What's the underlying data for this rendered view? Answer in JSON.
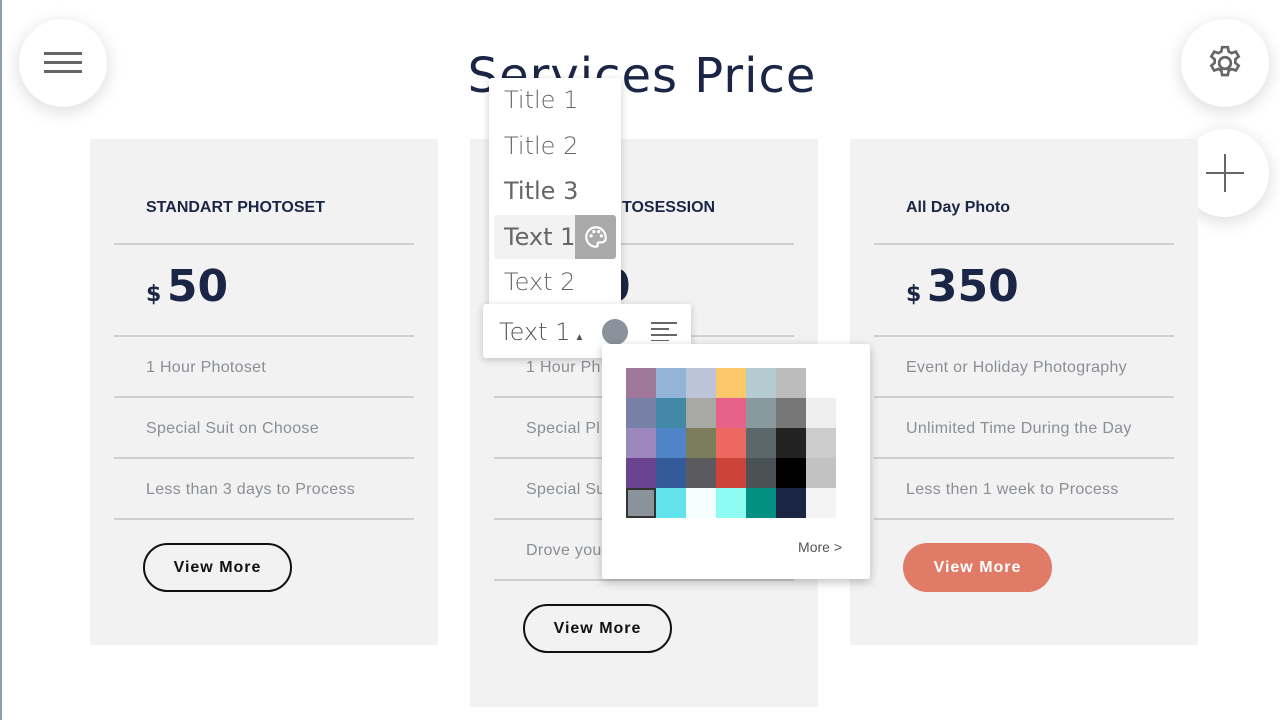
{
  "header": {
    "title": "Services Price",
    "menu_icon": "hamburger-icon",
    "settings_icon": "gear-icon",
    "add_icon": "plus-icon"
  },
  "cards": [
    {
      "title": "STANDART PHOTOSET",
      "currency": "$",
      "price": "50",
      "features": [
        "1 Hour Photoset",
        "Special Suit on Choose",
        "Less than 3 days to Process"
      ],
      "button": "View More"
    },
    {
      "title": "TOSESSION",
      "currency": "",
      "price": "0",
      "features": [
        "1 Hour Ph",
        "Special Pl",
        "Special Su",
        "Drove you"
      ],
      "button": "View More"
    },
    {
      "title": "All Day Photo",
      "currency": "$",
      "price": "350",
      "features": [
        "Event or Holiday Photography",
        "Unlimited Time During the Day",
        "Less then 1 week to Process"
      ],
      "button": "View More",
      "accent": "#e07b67"
    }
  ],
  "style_dropdown": {
    "items": [
      "Title 1",
      "Title 2",
      "Title 3",
      "Text 1",
      "Text 2"
    ],
    "selected": "Text 1",
    "palette_icon": "palette-icon"
  },
  "toolbar": {
    "style_label": "Text 1",
    "color": "#8a939c",
    "align_icon": "align-left-icon"
  },
  "palette": {
    "rows": [
      [
        "#9e7799",
        "#93b4d6",
        "#bdc3d9",
        "#f9c86a",
        "#b4cbd1",
        "#bcbcbc",
        null
      ],
      [
        "#7780a6",
        "#4189a7",
        "#a8a9a4",
        "#e8618a",
        "#889a9e",
        "#777777",
        "#efefef"
      ],
      [
        "#9d88bd",
        "#4f84c8",
        "#7c7d5a",
        "#ec6961",
        "#5c676c",
        "#222222",
        "#cccccc"
      ],
      [
        "#6b4491",
        "#345a99",
        "#5a5a5f",
        "#cb4339",
        "#4a5253",
        "#000000",
        "#c2c2c2"
      ],
      [
        "#8a939c",
        "#62e2ea",
        "#f6ffff",
        "#8dfdf4",
        "#008f80",
        "#1b2545",
        "#f4f4f4"
      ]
    ],
    "selected": "#8a939c",
    "more": "More >"
  }
}
